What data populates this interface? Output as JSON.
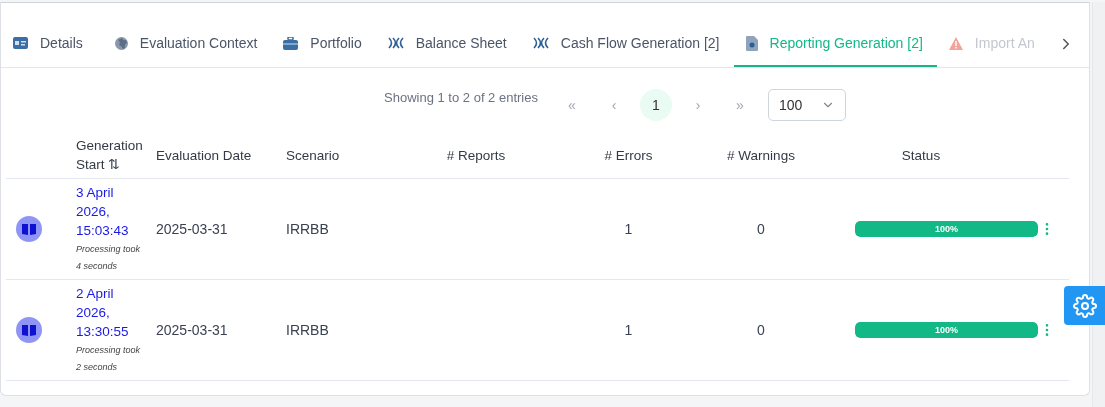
{
  "tabs": [
    {
      "label": "Details",
      "kind": "card",
      "selected": false,
      "faded": false
    },
    {
      "label": "Evaluation Context",
      "kind": "globe",
      "selected": false,
      "faded": false
    },
    {
      "label": "Portfolio",
      "kind": "briefcase",
      "selected": false,
      "faded": false
    },
    {
      "label": "Balance Sheet",
      "kind": "link",
      "selected": false,
      "faded": false
    },
    {
      "label": "Cash Flow Generation [2]",
      "kind": "link",
      "selected": false,
      "faded": false
    },
    {
      "label": "Reporting Generation [2]",
      "kind": "report",
      "selected": true,
      "faded": false
    },
    {
      "label": "Import An",
      "kind": "warning",
      "selected": false,
      "faded": true
    }
  ],
  "pagination": {
    "summary": "Showing 1 to 2 of 2 entries",
    "first": "«",
    "prev": "‹",
    "pages": [
      {
        "label": "1",
        "selected": true
      }
    ],
    "next": "›",
    "last": "»",
    "page_size": "100"
  },
  "table": {
    "columns": [
      "Generation Start",
      "Evaluation Date",
      "Scenario",
      "# Reports",
      "# Errors",
      "# Warnings",
      "Status"
    ],
    "sort_icon": "⇅",
    "rows": [
      {
        "generation_start": "3 April 2026, 15:03:43",
        "duration": "Processing took 4 seconds",
        "evaluation_date": "2025-03-31",
        "scenario": "IRRBB",
        "errors": "1",
        "warnings": "0",
        "level": 1,
        "status": "100%"
      },
      {
        "generation_start": "2 April 2026, 13:30:55",
        "duration": "Processing took 2 seconds",
        "evaluation_date": "2025-03-31",
        "scenario": "IRRBB",
        "errors": "1",
        "warnings": "0",
        "level": 1,
        "status": "100%"
      }
    ]
  }
}
